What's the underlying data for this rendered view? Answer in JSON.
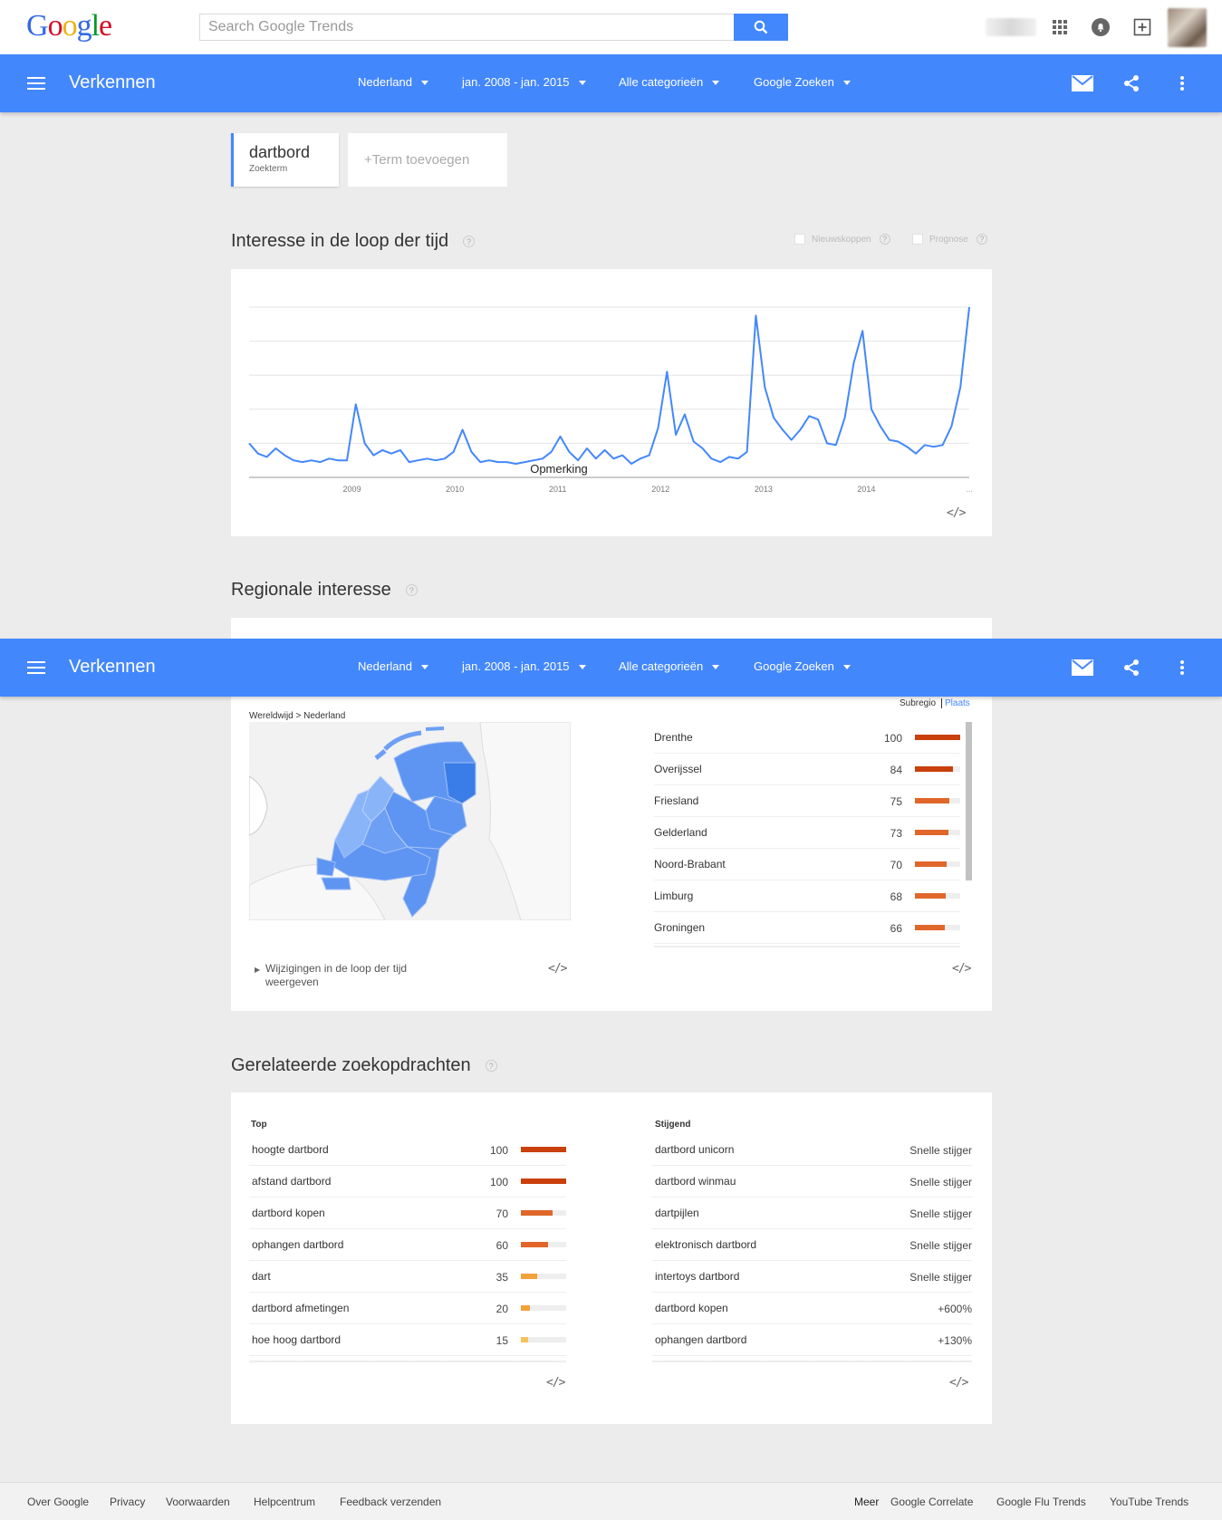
{
  "google_bar": {
    "logo": [
      "G",
      "o",
      "o",
      "g",
      "l",
      "e"
    ],
    "logo_colors": [
      "#3369e8",
      "#d50f25",
      "#eeb211",
      "#3369e8",
      "#009925",
      "#d50f25"
    ],
    "search_placeholder": "Search Google Trends"
  },
  "toolbar": {
    "title": "Verkennen",
    "filters": [
      "Nederland",
      "jan. 2008 - jan. 2015",
      "Alle categorieën",
      "Google Zoeken"
    ]
  },
  "terms": {
    "term": "dartbord",
    "term_type": "Zoekterm",
    "add_term": "+Term toevoegen"
  },
  "interest": {
    "title": "Interesse in de loop der tijd",
    "help": "?",
    "checkbox_news": "Nieuwskoppen",
    "checkbox_forecast": "Prognose",
    "annotation": "Opmerking",
    "embed": "</>",
    "ellipsis": "..."
  },
  "chart_data": {
    "type": "line",
    "title": "",
    "x_tick_labels": [
      "2009",
      "2010",
      "2011",
      "2012",
      "2013",
      "2014"
    ],
    "x_start": "2008-01",
    "x_end": "2015-01",
    "ylim": [
      0,
      100
    ],
    "series": [
      {
        "values": [
          20,
          14,
          12,
          17,
          13,
          10,
          9,
          10,
          9,
          11,
          10,
          10,
          43,
          20,
          13,
          16,
          14,
          16,
          9,
          10,
          11,
          10,
          11,
          15,
          28,
          15,
          9,
          10,
          9,
          9,
          8,
          9,
          10,
          11,
          15,
          24,
          15,
          10,
          17,
          11,
          16,
          11,
          13,
          8,
          11,
          13,
          29,
          62,
          25,
          37,
          21,
          17,
          11,
          9,
          12,
          11,
          15,
          95,
          53,
          35,
          28,
          22,
          28,
          36,
          34,
          20,
          19,
          35,
          67,
          86,
          40,
          30,
          22,
          21,
          18,
          14,
          19,
          18,
          19,
          30,
          53,
          100
        ],
        "color": "#4387fd"
      }
    ]
  },
  "regional": {
    "title": "Regionale interesse",
    "help": "?",
    "breadcrumb": "Wereldwijd > Nederland",
    "toggle_sub": "Subregio",
    "toggle_city": "Plaats",
    "changes_link": "Wijzigingen in de loop der tijd weergeven",
    "embed": "</>",
    "rows": [
      {
        "name": "Drenthe",
        "value": 100
      },
      {
        "name": "Overijssel",
        "value": 84
      },
      {
        "name": "Friesland",
        "value": 75
      },
      {
        "name": "Gelderland",
        "value": 73
      },
      {
        "name": "Noord-Brabant",
        "value": 70
      },
      {
        "name": "Limburg",
        "value": 68
      },
      {
        "name": "Groningen",
        "value": 66
      }
    ],
    "map_colors": {
      "light": "#8ab4f8",
      "mid": "#5f95f2",
      "dark": "#3b7de8",
      "land": "#f2f2f2"
    }
  },
  "related": {
    "title": "Gerelateerde zoekopdrachten",
    "help": "?",
    "top_label": "Top",
    "rising_label": "Stijgend",
    "embed": "</>",
    "top": [
      {
        "name": "hoogte dartbord",
        "value": 100
      },
      {
        "name": "afstand dartbord",
        "value": 100
      },
      {
        "name": "dartbord kopen",
        "value": 70
      },
      {
        "name": "ophangen dartbord",
        "value": 60
      },
      {
        "name": "dart",
        "value": 35
      },
      {
        "name": "dartbord afmetingen",
        "value": 20
      },
      {
        "name": "hoe hoog dartbord",
        "value": 15
      }
    ],
    "rising": [
      {
        "name": "dartbord unicorn",
        "value": "Snelle stijger"
      },
      {
        "name": "dartbord winmau",
        "value": "Snelle stijger"
      },
      {
        "name": "dartpijlen",
        "value": "Snelle stijger"
      },
      {
        "name": "elektronisch dartbord",
        "value": "Snelle stijger"
      },
      {
        "name": "intertoys dartbord",
        "value": "Snelle stijger"
      },
      {
        "name": "dartbord kopen",
        "value": "+600%"
      },
      {
        "name": "ophangen dartbord",
        "value": "+130%"
      }
    ]
  },
  "footer": {
    "left": [
      "Over Google",
      "Privacy",
      "Voorwaarden",
      "Helpcentrum",
      "Feedback verzenden"
    ],
    "more": "Meer",
    "right": [
      "Google Correlate",
      "Google Flu Trends",
      "YouTube Trends"
    ]
  }
}
